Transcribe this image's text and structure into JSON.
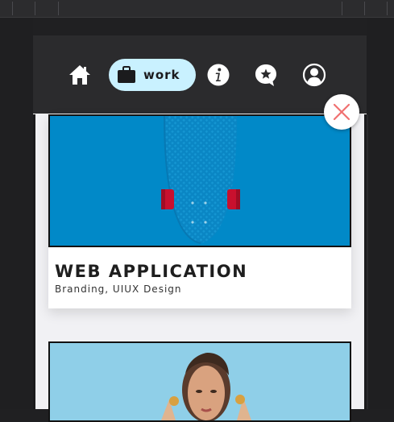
{
  "nav": {
    "items": [
      {
        "icon": "home-icon"
      },
      {
        "icon": "briefcase-icon",
        "label": "work",
        "active": true
      },
      {
        "icon": "info-icon"
      },
      {
        "icon": "star-chat-icon"
      },
      {
        "icon": "user-icon"
      }
    ],
    "active_color": "#c9f1ff"
  },
  "close": {
    "icon": "close-icon",
    "color": "#f07070"
  },
  "projects": [
    {
      "title": "WEB APPLICATION",
      "tags": "Branding, UIUX Design",
      "image": "skateboard-photo"
    },
    {
      "image": "portrait-photo"
    }
  ]
}
